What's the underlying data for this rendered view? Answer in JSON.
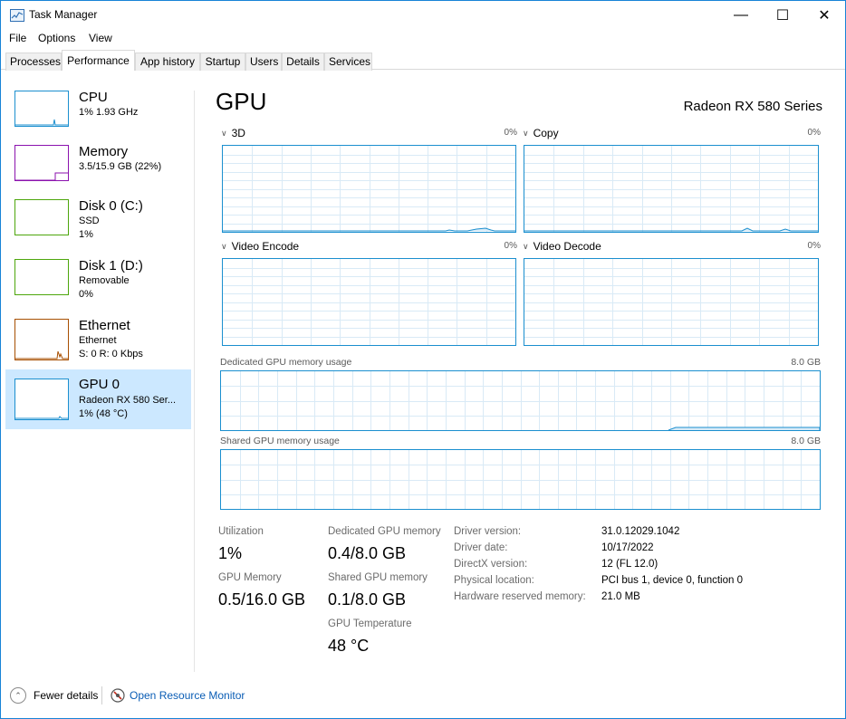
{
  "window": {
    "title": "Task Manager",
    "controls": {
      "minimize": "—",
      "maximize": "☐",
      "close": "✕"
    }
  },
  "menu": [
    "File",
    "Options",
    "View"
  ],
  "tabs": [
    "Processes",
    "Performance",
    "App history",
    "Startup",
    "Users",
    "Details",
    "Services"
  ],
  "active_tab": "Performance",
  "sidebar": {
    "items": [
      {
        "title": "CPU",
        "line1": "1% 1.93 GHz",
        "line2": "",
        "color": "#1b8fcf"
      },
      {
        "title": "Memory",
        "line1": "3.5/15.9 GB (22%)",
        "line2": "",
        "color": "#8b12ae"
      },
      {
        "title": "Disk 0 (C:)",
        "line1": "SSD",
        "line2": "1%",
        "color": "#4da60c"
      },
      {
        "title": "Disk 1 (D:)",
        "line1": "Removable",
        "line2": "0%",
        "color": "#4da60c"
      },
      {
        "title": "Ethernet",
        "line1": "Ethernet",
        "line2": "S: 0 R: 0 Kbps",
        "color": "#a74f01"
      },
      {
        "title": "GPU 0",
        "line1": "Radeon RX 580 Ser...",
        "line2": "1% (48 °C)",
        "color": "#1b8fcf"
      }
    ],
    "selected_index": 5
  },
  "gpu": {
    "title": "GPU",
    "model": "Radeon RX 580 Series",
    "graphs": [
      {
        "label": "3D",
        "value": "0%"
      },
      {
        "label": "Copy",
        "value": "0%"
      },
      {
        "label": "Video Encode",
        "value": "0%"
      },
      {
        "label": "Video Decode",
        "value": "0%"
      }
    ],
    "dedicated_memory": {
      "label": "Dedicated GPU memory usage",
      "max": "8.0 GB"
    },
    "shared_memory": {
      "label": "Shared GPU memory usage",
      "max": "8.0 GB"
    },
    "stats": {
      "utilization": {
        "label": "Utilization",
        "value": "1%"
      },
      "dedicated_gpu_memory": {
        "label": "Dedicated GPU memory",
        "value": "0.4/8.0 GB"
      },
      "gpu_memory": {
        "label": "GPU Memory",
        "value": "0.5/16.0 GB"
      },
      "shared_gpu_memory": {
        "label": "Shared GPU memory",
        "value": "0.1/8.0 GB"
      },
      "gpu_temperature": {
        "label": "GPU Temperature",
        "value": "48 °C"
      }
    },
    "info": [
      {
        "label": "Driver version:",
        "value": "31.0.12029.1042"
      },
      {
        "label": "Driver date:",
        "value": "10/17/2022"
      },
      {
        "label": "DirectX version:",
        "value": "12 (FL 12.0)"
      },
      {
        "label": "Physical location:",
        "value": "PCI bus 1, device 0, function 0"
      },
      {
        "label": "Hardware reserved memory:",
        "value": "21.0 MB"
      }
    ]
  },
  "footer": {
    "fewer_details": "Fewer details",
    "open_resource_monitor": "Open Resource Monitor"
  },
  "colors": {
    "accent": "#1b8fcf",
    "selected_bg": "#cce8ff",
    "link": "#0a5db5",
    "window_border": "#1883d7"
  }
}
